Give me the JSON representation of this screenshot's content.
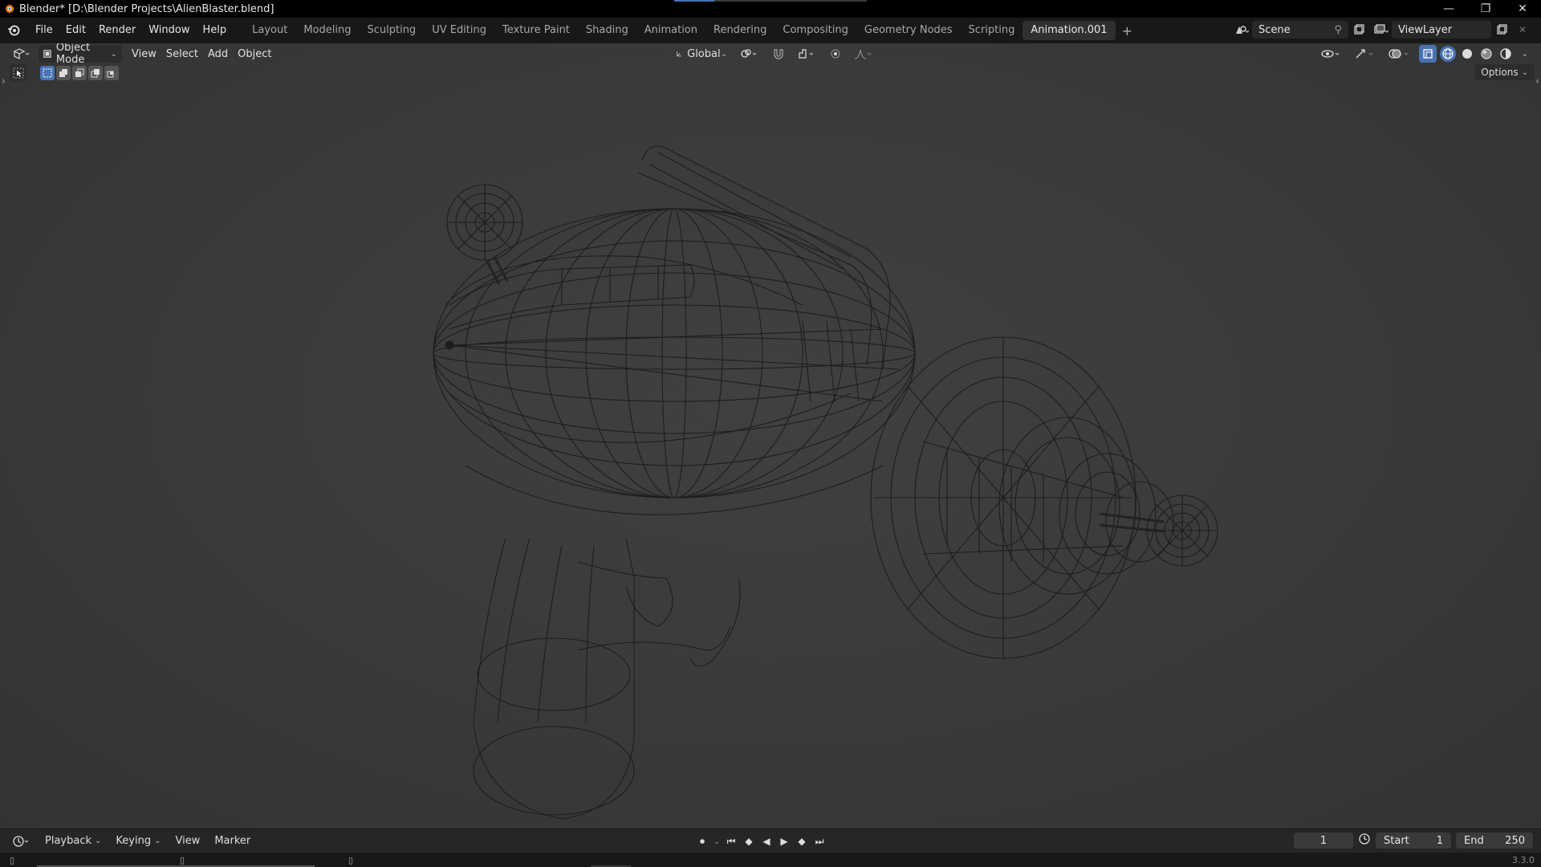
{
  "window": {
    "title": "Blender* [D:\\Blender Projects\\AlienBlaster.blend]",
    "controls": [
      "—",
      "❐",
      "✕"
    ]
  },
  "menu": [
    "File",
    "Edit",
    "Render",
    "Window",
    "Help"
  ],
  "workspaces": [
    {
      "label": "Layout",
      "active": false
    },
    {
      "label": "Modeling",
      "active": false
    },
    {
      "label": "Sculpting",
      "active": false
    },
    {
      "label": "UV Editing",
      "active": false
    },
    {
      "label": "Texture Paint",
      "active": false
    },
    {
      "label": "Shading",
      "active": false
    },
    {
      "label": "Animation",
      "active": false
    },
    {
      "label": "Rendering",
      "active": false
    },
    {
      "label": "Compositing",
      "active": false
    },
    {
      "label": "Geometry Nodes",
      "active": false
    },
    {
      "label": "Scripting",
      "active": false
    },
    {
      "label": "Animation.001",
      "active": true
    }
  ],
  "scene": {
    "name": "Scene"
  },
  "view_layer": {
    "name": "ViewLayer"
  },
  "viewport_header": {
    "mode": "Object Mode",
    "menus": [
      "View",
      "Select",
      "Add",
      "Object"
    ],
    "transform_orientation": "Global",
    "options_label": "Options"
  },
  "timeline": {
    "menus": [
      "Playback",
      "Keying",
      "View",
      "Marker"
    ],
    "current_frame": "1",
    "start_label": "Start",
    "start_value": "1",
    "end_label": "End",
    "end_value": "250"
  },
  "statusbar": {
    "version": "3.3.0"
  },
  "colors": {
    "accent": "#4772b3",
    "wire": "#1a1a1a"
  }
}
